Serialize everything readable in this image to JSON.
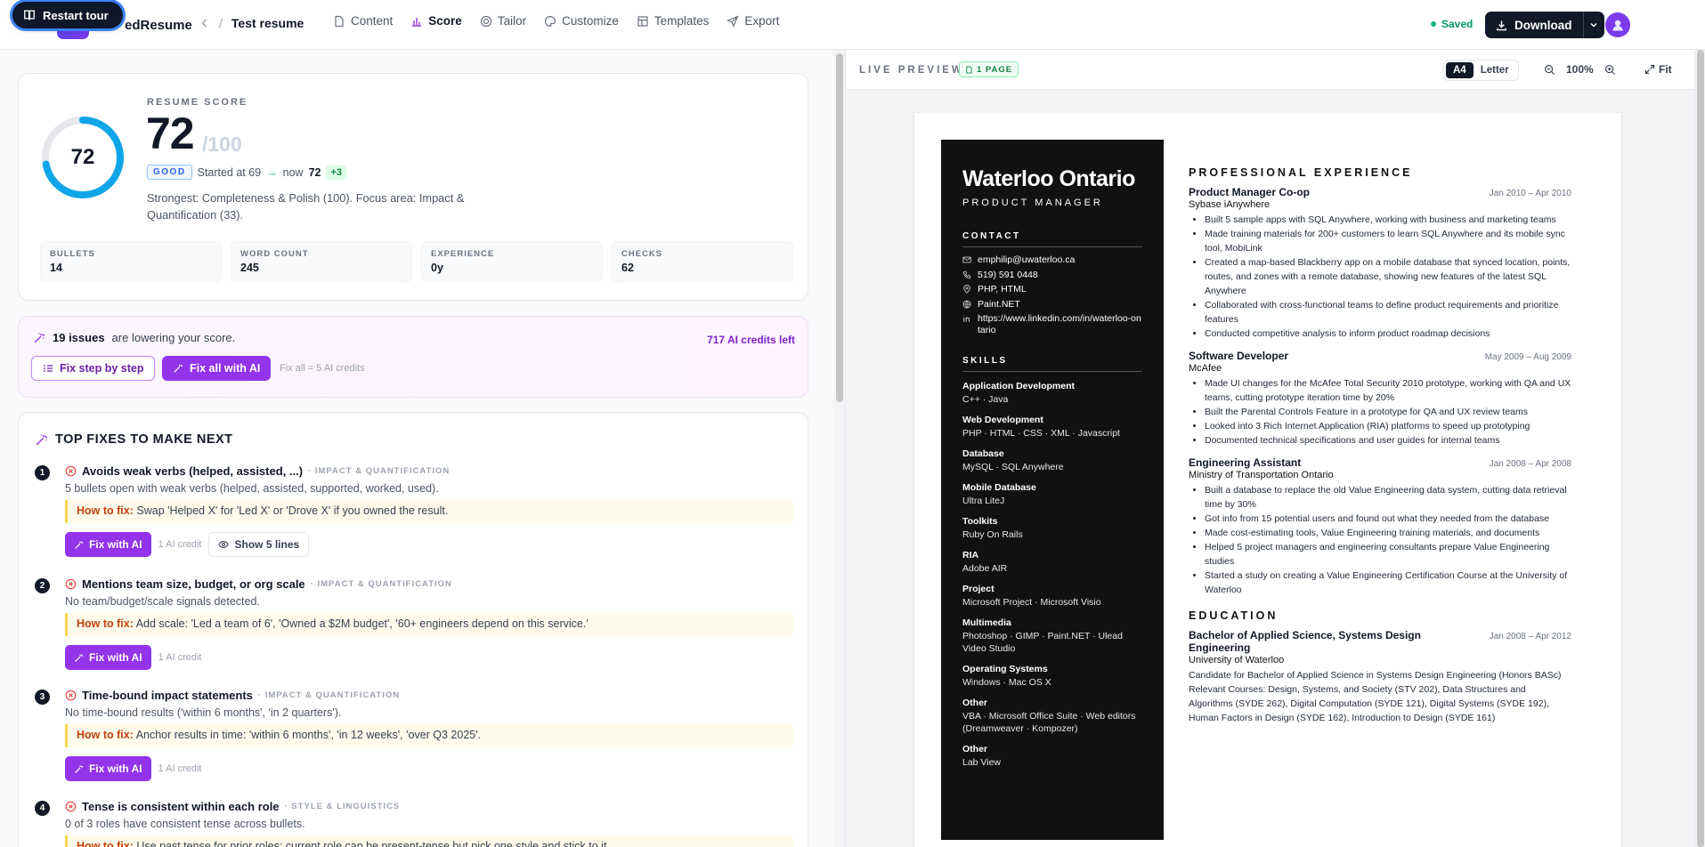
{
  "topbar": {
    "tour_label": "Restart tour",
    "brand": "edResume",
    "doc_title": "Test resume",
    "separator": "/",
    "tabs": [
      {
        "label": "Content",
        "icon": "document-icon"
      },
      {
        "label": "Score",
        "icon": "bar-chart-icon"
      },
      {
        "label": "Tailor",
        "icon": "target-icon"
      },
      {
        "label": "Customize",
        "icon": "palette-icon"
      },
      {
        "label": "Templates",
        "icon": "layout-icon"
      },
      {
        "label": "Export",
        "icon": "send-icon"
      }
    ],
    "active_tab": "Score",
    "saved_label": "Saved",
    "download_label": "Download"
  },
  "score": {
    "label": "RESUME SCORE",
    "value": "72",
    "max": "/100",
    "fraction": 0.72,
    "grade": "GOOD",
    "started": "Started at 69",
    "now_prefix": "now",
    "now": "72",
    "delta": "+3",
    "description": "Strongest: Completeness & Polish (100). Focus area: Impact & Quantification (33).",
    "stats": [
      {
        "key": "BULLETS",
        "value": "14"
      },
      {
        "key": "WORD COUNT",
        "value": "245"
      },
      {
        "key": "EXPERIENCE",
        "value": "0y"
      },
      {
        "key": "CHECKS",
        "value": "62"
      }
    ]
  },
  "issues": {
    "count": "19 issues",
    "text": "are lowering your score.",
    "credits": "717 AI credits left",
    "step_label": "Fix step by step",
    "ai_label": "Fix all with AI",
    "note": "Fix all = 5 AI credits"
  },
  "fixes": {
    "title": "TOP FIXES TO MAKE NEXT",
    "howto_label": "How to fix:",
    "ai_label": "Fix with AI",
    "credit_note": "1 AI credit",
    "items": [
      {
        "num": "1",
        "title": "Avoids weak verbs (helped, assisted, ...)",
        "cat": "· IMPACT & QUANTIFICATION",
        "desc": "5 bullets open with weak verbs (helped, assisted, supported, worked, used).",
        "howto": "Swap 'Helped X' for 'Led X' or 'Drove X' if you owned the result.",
        "extra": "Show 5 lines"
      },
      {
        "num": "2",
        "title": "Mentions team size, budget, or org scale",
        "cat": "· IMPACT & QUANTIFICATION",
        "desc": "No team/budget/scale signals detected.",
        "howto": "Add scale: 'Led a team of 6', 'Owned a $2M budget', '60+ engineers depend on this service.'"
      },
      {
        "num": "3",
        "title": "Time-bound impact statements",
        "cat": "· IMPACT & QUANTIFICATION",
        "desc": "No time-bound results ('within 6 months', 'in 2 quarters').",
        "howto": "Anchor results in time: 'within 6 months', 'in 12 weeks', 'over Q3 2025'."
      },
      {
        "num": "4",
        "title": "Tense is consistent within each role",
        "cat": "· STYLE & LINGUISTICS",
        "desc": "0 of 3 roles have consistent tense across bullets.",
        "howto": "Use past tense for prior roles; current role can be present-tense but pick one style and stick to it."
      }
    ]
  },
  "preview": {
    "label": "LIVE PREVIEW",
    "pages": "1 PAGE",
    "paper_a4": "A4",
    "paper_letter": "Letter",
    "zoom": "100%",
    "fit": "Fit"
  },
  "resume": {
    "name": "Waterloo Ontario",
    "role": "PRODUCT MANAGER",
    "contact_h": "CONTACT",
    "contact": [
      {
        "icon": "mail-icon",
        "text": "emphilip@uwaterloo.ca"
      },
      {
        "icon": "phone-icon",
        "text": "519) 591 0448"
      },
      {
        "icon": "location-icon",
        "text": "PHP, HTML"
      },
      {
        "icon": "globe-icon",
        "text": "Paint.NET"
      },
      {
        "icon": "linkedin-icon",
        "text": "https://www.linkedin.com/in/waterloo-ontario"
      }
    ],
    "skills_h": "SKILLS",
    "skills": [
      {
        "t": "Application Development",
        "d": "C++ · Java"
      },
      {
        "t": "Web Development",
        "d": "PHP · HTML · CSS · XML · Javascript"
      },
      {
        "t": "Database",
        "d": "MySQL · SQL Anywhere"
      },
      {
        "t": "Mobile Database",
        "d": "Ultra LiteJ"
      },
      {
        "t": "Toolkits",
        "d": "Ruby On Rails"
      },
      {
        "t": "RIA",
        "d": "Adobe AIR"
      },
      {
        "t": "Project",
        "d": "Microsoft Project · Microsoft Visio"
      },
      {
        "t": "Multimedia",
        "d": "Photoshop · GIMP · Paint.NET · Ulead Video Studio"
      },
      {
        "t": "Operating Systems",
        "d": "Windows · Mac OS X"
      },
      {
        "t": "Other",
        "d": "VBA · Microsoft Office Suite · Web editors (Dreamweaver · Kompozer)"
      },
      {
        "t": "Other",
        "d": "Lab View"
      }
    ],
    "exp_h": "PROFESSIONAL EXPERIENCE",
    "jobs": [
      {
        "title": "Product Manager Co-op",
        "date": "Jan 2010 – Apr 2010",
        "company": "Sybase iAnywhere",
        "bullets": [
          "Built 5 sample apps with SQL Anywhere, working with business and marketing teams",
          "Made training materials for 200+ customers to learn SQL Anywhere and its mobile sync tool, MobiLink",
          "Created a map-based Blackberry app on a mobile database that synced location, points, routes, and zones with a remote database, showing new features of the latest SQL Anywhere",
          "Collaborated with cross-functional teams to define product requirements and prioritize features",
          "Conducted competitive analysis to inform product roadmap decisions"
        ]
      },
      {
        "title": "Software Developer",
        "date": "May 2009 – Aug 2009",
        "company": "McAfee",
        "bullets": [
          "Made UI changes for the McAfee Total Security 2010 prototype, working with QA and UX teams, cutting prototype iteration time by 20%",
          "Built the Parental Controls Feature in a prototype for QA and UX review teams",
          "Looked into 3 Rich Internet Application (RIA) platforms to speed up prototyping",
          "Documented technical specifications and user guides for internal teams"
        ]
      },
      {
        "title": "Engineering Assistant",
        "date": "Jan 2008 – Apr 2008",
        "company": "Ministry of Transportation Ontario",
        "bullets": [
          "Built a database to replace the old Value Engineering data system, cutting data retrieval time by 30%",
          "Got info from 15 potential users and found out what they needed from the database",
          "Made cost-estimating tools, Value Engineering training materials, and documents",
          "Helped 5 project managers and engineering consultants prepare Value Engineering studies",
          "Started a study on creating a Value Engineering Certification Course at the University of Waterloo"
        ]
      }
    ],
    "edu_h": "EDUCATION",
    "edu": {
      "degree": "Bachelor of Applied Science, Systems Design Engineering",
      "date": "Jan 2008 – Apr 2012",
      "school": "University of Waterloo",
      "desc": "Candidate for Bachelor of Applied Science in Systems Design Engineering (Honors BASc) Relevant Courses: Design, Systems, and Society (STV 202), Data Structures and Algorithms (SYDE 262), Digital Computation (SYDE 121), Digital Systems (SYDE 192), Human Factors in Design (SYDE 162), Introduction to Design (SYDE 161)"
    }
  }
}
